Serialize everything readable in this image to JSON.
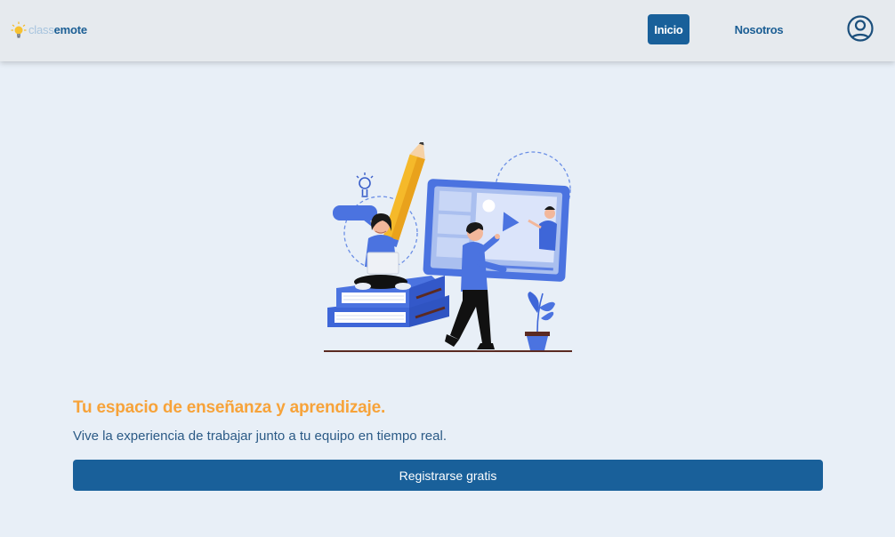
{
  "brand": {
    "light": "class",
    "bold": "emote"
  },
  "nav": {
    "inicio": "Inicio",
    "nosotros": "Nosotros"
  },
  "hero": {
    "headline": "Tu espacio de enseñanza y aprendizaje.",
    "subline": "Vive la experiencia de trabajar junto a tu equipo en tiempo real.",
    "cta": "Registrarse gratis"
  },
  "colors": {
    "primary": "#19609a",
    "accent": "#f7a33a",
    "background": "#e8eff7",
    "navbar": "#e6eaee",
    "illustration_blue": "#4b73e0"
  },
  "icons": {
    "logo": "lightbulb-icon",
    "account": "user-circle-icon",
    "illustration": "online-learning-illustration"
  }
}
